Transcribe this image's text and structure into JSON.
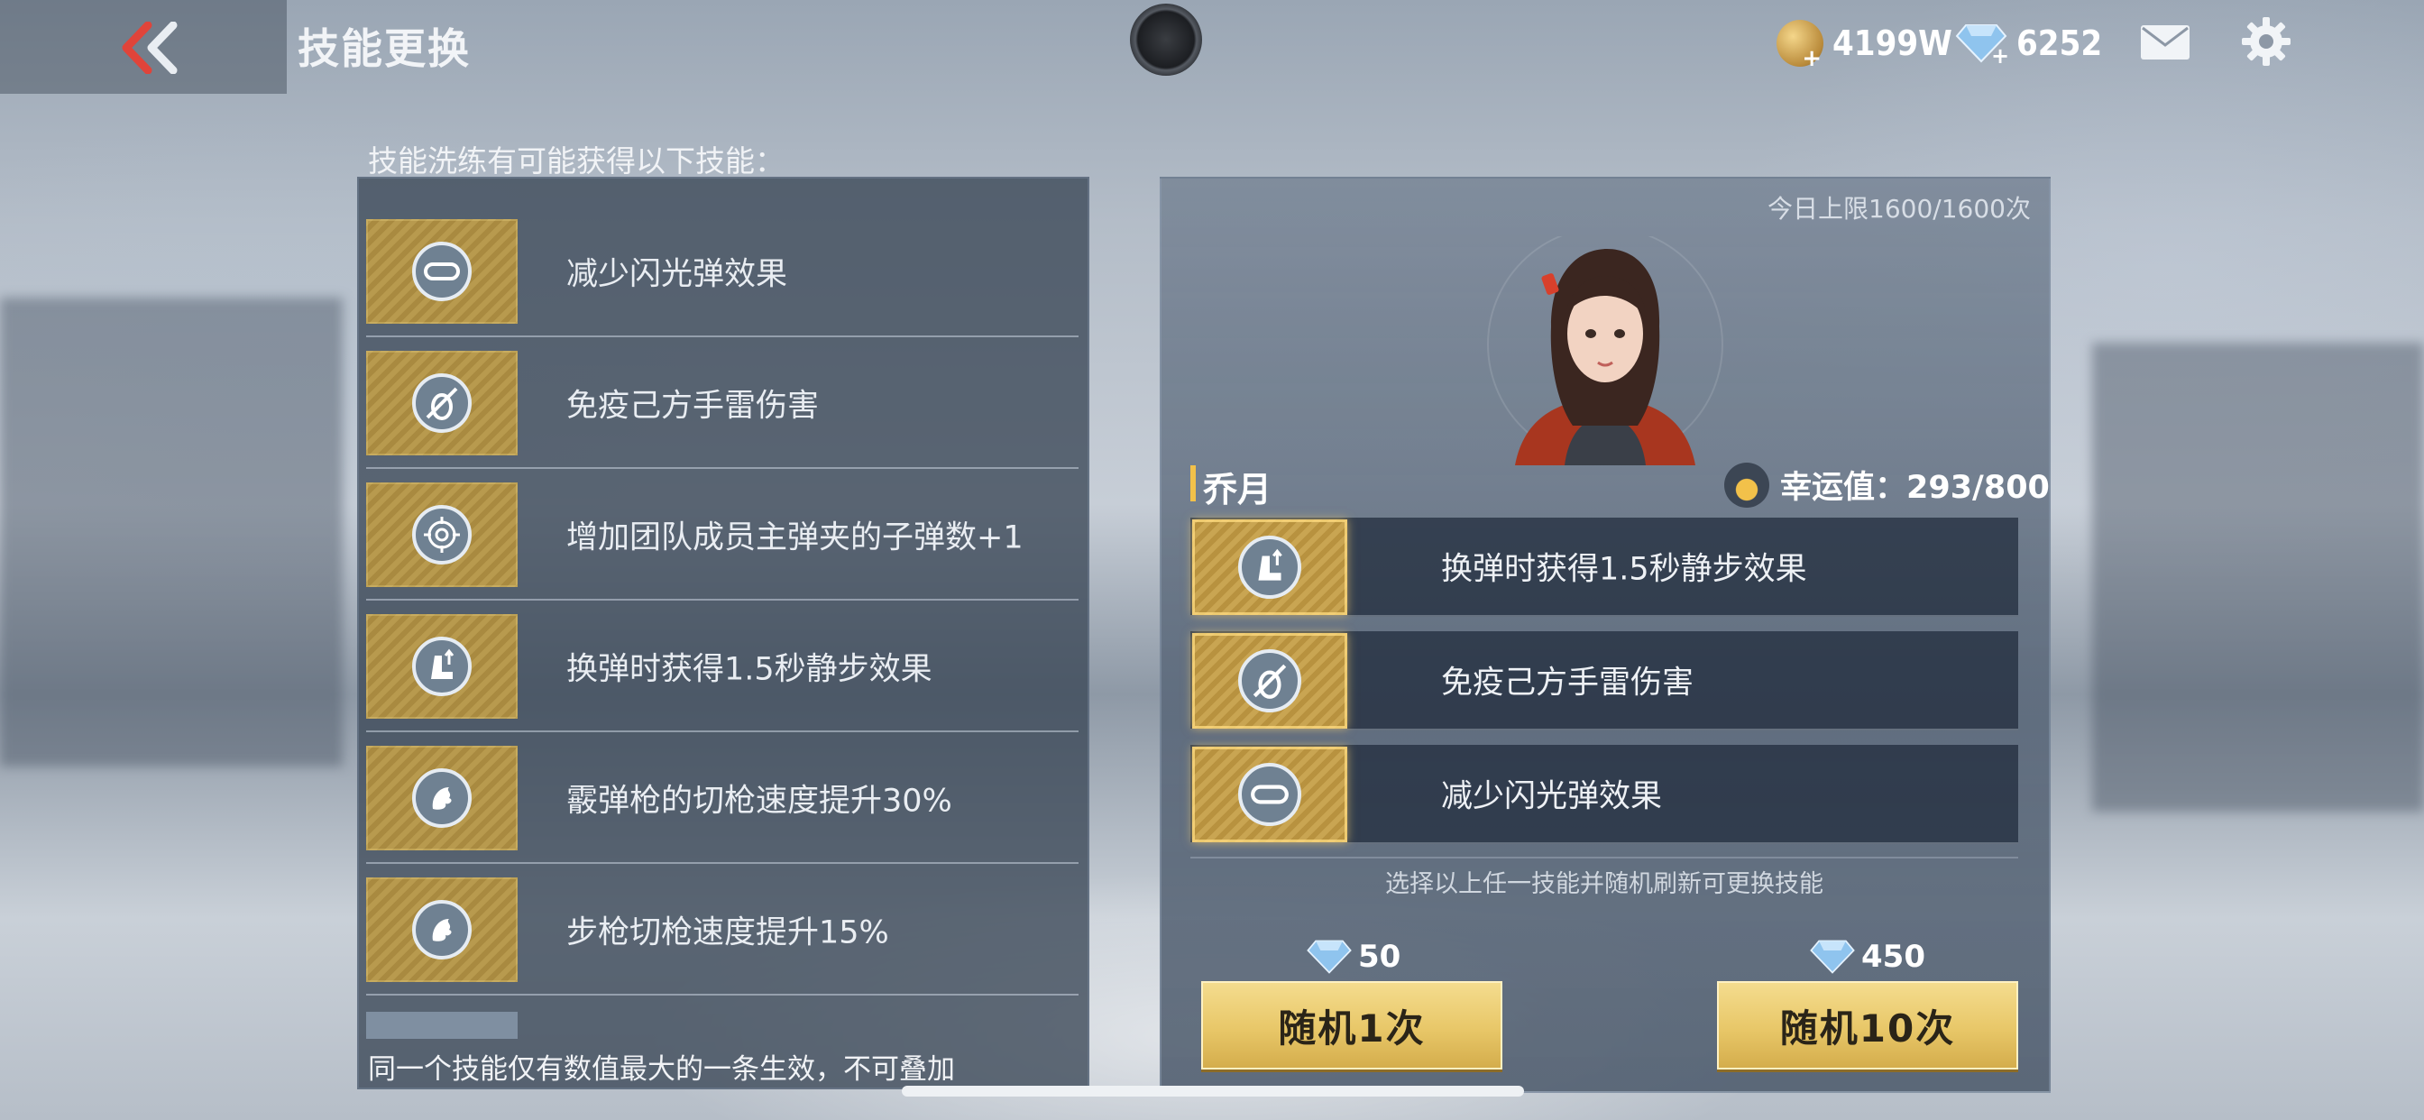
{
  "header": {
    "title": "技能更换",
    "gold": "4199W",
    "diamonds": "6252"
  },
  "left_panel": {
    "heading": "技能洗练有可能获得以下技能：",
    "skills": [
      {
        "icon": "goggles-icon",
        "label": "减少闪光弹效果"
      },
      {
        "icon": "grenade-immunity-icon",
        "label": "免疫己方手雷伤害"
      },
      {
        "icon": "crosshair-icon",
        "label": "增加团队成员主弹夹的子弹数+1"
      },
      {
        "icon": "boot-icon",
        "label": "换弹时获得1.5秒静步效果"
      },
      {
        "icon": "dragon-icon",
        "label": "霰弹枪的切枪速度提升30%"
      },
      {
        "icon": "dragon-icon",
        "label": "步枪切枪速度提升15%"
      }
    ],
    "footer": "同一个技能仅有数值最大的一条生效，不可叠加"
  },
  "right_panel": {
    "daily_limit": "今日上限1600/1600次",
    "character_name": "乔月",
    "luck_label": "幸运值：293/800",
    "current_skills": [
      {
        "icon": "boot-icon",
        "label": "换弹时获得1.5秒静步效果"
      },
      {
        "icon": "grenade-immunity-icon",
        "label": "免疫己方手雷伤害"
      },
      {
        "icon": "goggles-icon",
        "label": "减少闪光弹效果"
      }
    ],
    "hint": "选择以上任一技能并随机刷新可更换技能",
    "random_once": {
      "cost": "50",
      "label": "随机1次"
    },
    "random_ten": {
      "cost": "450",
      "label": "随机10次"
    }
  },
  "colors": {
    "accent_gold": "#e8c768",
    "name_bar": "#f2c14a",
    "back_red": "#e0443a"
  }
}
